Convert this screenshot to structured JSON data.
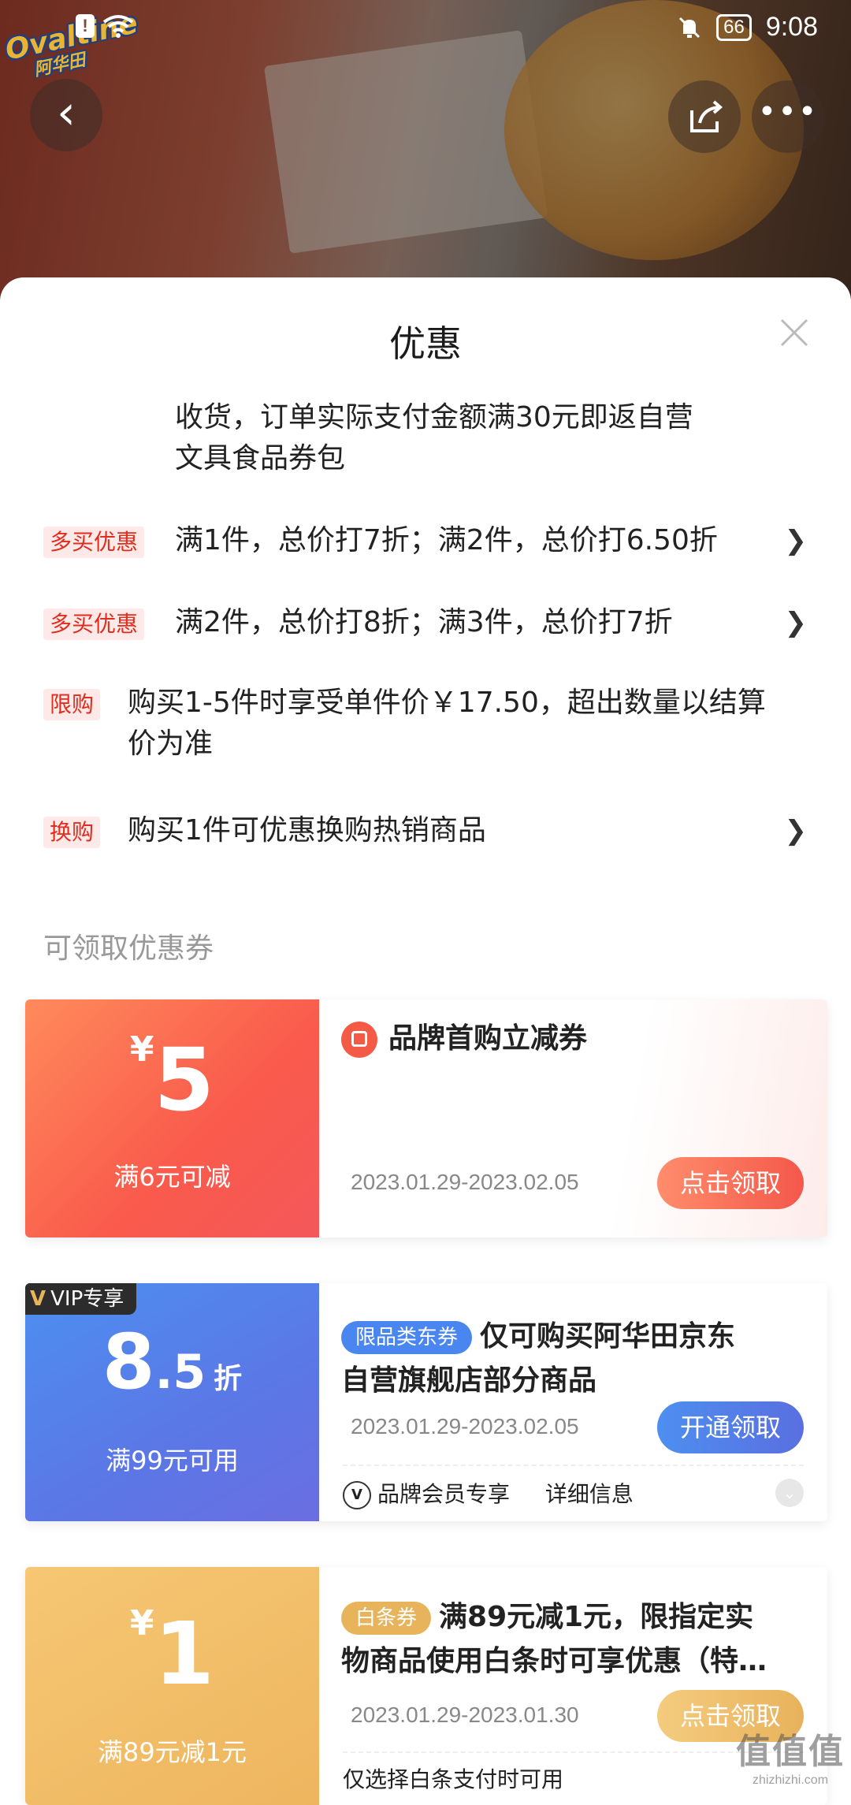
{
  "status_bar": {
    "time": "9:08",
    "battery": "66"
  },
  "brand_logo": {
    "text": "Ovaltine",
    "cn": "阿华田"
  },
  "sheet": {
    "title": "优惠",
    "promos": [
      {
        "text_line1": "收货，订单实际支付金额满30元即返自营",
        "text_line2": "文具食品券包"
      },
      {
        "tag": "多买优惠",
        "text": "满1件，总价打7折；满2件，总价打6.50折",
        "arrow": "❯"
      },
      {
        "tag": "多买优惠",
        "text": "满2件，总价打8折；满3件，总价打7折",
        "arrow": "❯"
      },
      {
        "tag": "限购",
        "text_line1": "购买1-5件时享受单件价￥17.50，超出数量以结算",
        "text_line2": "价为准"
      },
      {
        "tag": "换购",
        "text": "购买1件可优惠换购热销商品",
        "arrow": "❯"
      }
    ],
    "section_label": "可领取优惠券",
    "coupons": [
      {
        "currency": "¥",
        "value": "5",
        "condition": "满6元可减",
        "title": "品牌首购立减券",
        "date": "2023.01.29-2023.02.05",
        "button": "点击领取"
      },
      {
        "vip_tag": "VIP专享",
        "value_int": "8",
        "value_dec": ".5",
        "unit": "折",
        "condition": "满99元可用",
        "pill": "限品类东券",
        "title_line1": "仅可购买阿华田京东",
        "title_line2": "自营旗舰店部分商品",
        "date": "2023.01.29-2023.02.05",
        "button": "开通领取",
        "member_note": "品牌会员专享",
        "details": "详细信息"
      },
      {
        "currency": "¥",
        "value": "1",
        "condition": "满89元减1元",
        "pill": "白条券",
        "title_line1": "满89元减1元，限指定实",
        "title_line2": "物商品使用白条时可享优惠（特…",
        "date": "2023.01.29-2023.01.30",
        "button": "点击领取",
        "footnote": "仅选择白条支付时可用"
      }
    ]
  },
  "watermark": {
    "cn": "值值值",
    "en": "zhizhizhi.com"
  },
  "colors": {
    "accent_red": "#e02d1f",
    "coupon_blue": "#4d8ff0",
    "coupon_gold": "#e7b45c"
  }
}
